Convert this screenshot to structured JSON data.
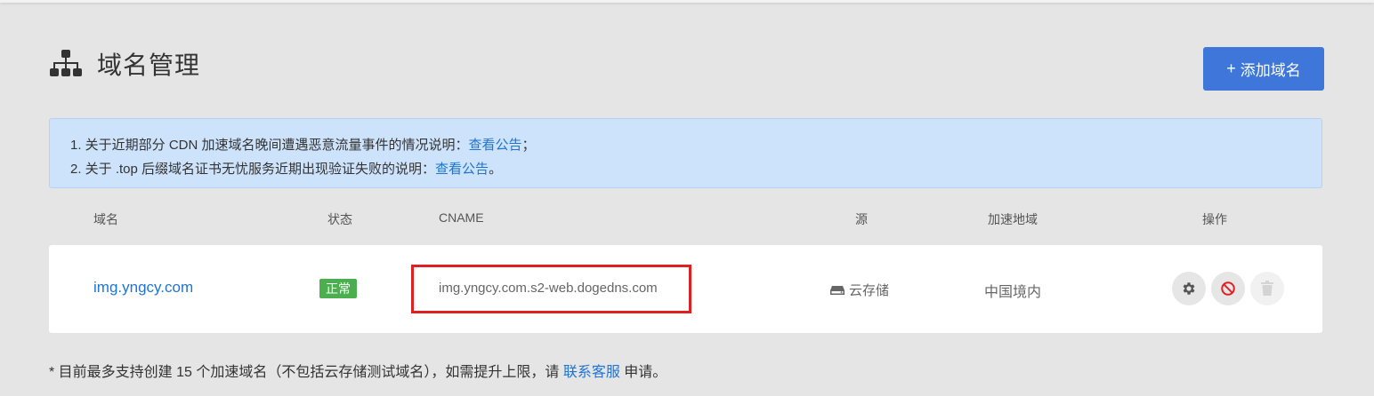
{
  "header": {
    "title": "域名管理",
    "add_button_plus": "+",
    "add_button_label": "添加域名"
  },
  "notice": {
    "line1_text": "1. 关于近期部分 CDN 加速域名晚间遭遇恶意流量事件的情况说明：",
    "line1_link": "查看公告",
    "line1_end": "；",
    "line2_text": "2. 关于 .top 后缀域名证书无忧服务近期出现验证失败的说明：",
    "line2_link": "查看公告",
    "line2_end": "。"
  },
  "table": {
    "columns": [
      "域名",
      "状态",
      "CNAME",
      "源",
      "加速地域",
      "操作"
    ],
    "rows": [
      {
        "domain": "img.yngcy.com",
        "status": "正常",
        "cname": "img.yngcy.com.s2-web.dogedns.com",
        "origin": "云存储",
        "region": "中国境内",
        "actions": [
          "gear-icon",
          "ban-icon",
          "trash-icon"
        ]
      }
    ]
  },
  "footer": {
    "text_before": "* 目前最多支持创建 15 个加速域名（不包括云存储测试域名），如需提升上限，请 ",
    "link": "联系客服",
    "text_after": " 申请。"
  },
  "colors": {
    "accent": "#3f76d9",
    "link": "#1f74d3",
    "status_ok": "#4bae4f",
    "highlight_box": "#e02020",
    "notice_bg": "#cde3fb"
  }
}
